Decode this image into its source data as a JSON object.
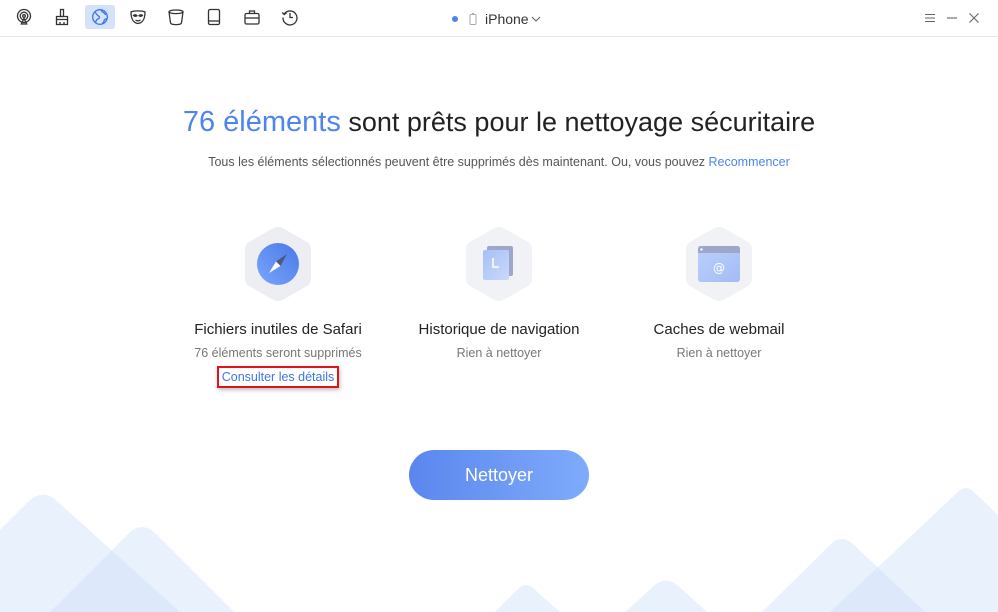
{
  "toolbar": {
    "icons": [
      {
        "name": "airplay-icon",
        "active": false
      },
      {
        "name": "brush-icon",
        "active": false
      },
      {
        "name": "globe-icon",
        "active": true
      },
      {
        "name": "mask-icon",
        "active": false
      },
      {
        "name": "bucket-icon",
        "active": false
      },
      {
        "name": "tablet-icon",
        "active": false
      },
      {
        "name": "briefcase-icon",
        "active": false
      },
      {
        "name": "history-icon",
        "active": false
      }
    ],
    "device_name": "iPhone",
    "status_color": "#4d84ee"
  },
  "main": {
    "headline_count": "76 éléments",
    "headline_rest": " sont prêts pour le nettoyage sécuritaire",
    "subline_text": "Tous les éléments sélectionnés peuvent être supprimés dès maintenant. Ou, vous pouvez ",
    "subline_link": "Recommencer",
    "cards": [
      {
        "title": "Fichiers inutiles de Safari",
        "desc": "76 éléments seront supprimés",
        "details_link": "Consulter les détails",
        "icon": "compass-icon"
      },
      {
        "title": "Historique de navigation",
        "desc": "Rien à nettoyer",
        "icon": "history-pages-icon"
      },
      {
        "title": "Caches de webmail",
        "desc": "Rien à nettoyer",
        "icon": "webmail-icon"
      }
    ],
    "clean_button": "Nettoyer"
  },
  "colors": {
    "accent": "#4d84ee",
    "highlight_box": "#e0151b",
    "button_gradient_start": "#5b86ee",
    "button_gradient_end": "#7eabfa"
  }
}
